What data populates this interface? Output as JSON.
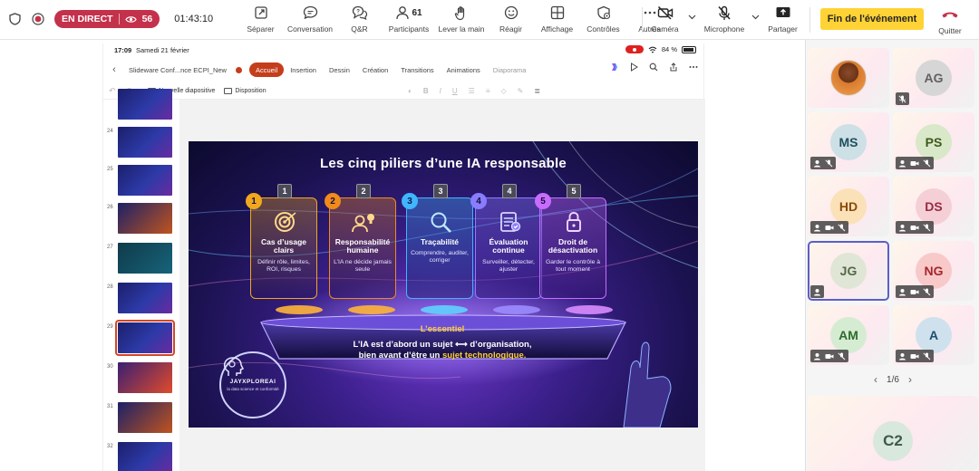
{
  "toolbar": {
    "live_label": "EN DIRECT",
    "viewer_count": "56",
    "timer": "01:43:10",
    "tools": [
      {
        "label": "Séparer",
        "icon": "pop-out-icon"
      },
      {
        "label": "Conversation",
        "icon": "chat-icon"
      },
      {
        "label": "Q&R",
        "icon": "qa-icon"
      },
      {
        "label": "Participants",
        "icon": "people-icon",
        "count": "61"
      },
      {
        "label": "Lever la main",
        "icon": "raise-hand-icon"
      },
      {
        "label": "Réagir",
        "icon": "smiley-icon"
      },
      {
        "label": "Affichage",
        "icon": "grid-view-icon"
      },
      {
        "label": "Contrôles",
        "icon": "controls-icon"
      },
      {
        "label": "Autres",
        "icon": "more-icon"
      },
      {
        "label": "Caméra",
        "icon": "camera-off-icon"
      },
      {
        "label": "Microphone",
        "icon": "mic-off-icon"
      },
      {
        "label": "Partager",
        "icon": "share-tray-icon"
      }
    ],
    "end_event": "Fin de l'événement",
    "quit": "Quitter",
    "colors": {
      "live": "#c4314b",
      "end": "#ffd335",
      "hangup": "#c4314b"
    }
  },
  "ipad": {
    "time": "17:09",
    "date": "Samedi 21 février",
    "battery": "84 %"
  },
  "powerpoint": {
    "file_name": "Slideware Conf...nce ECPI_New",
    "tabs": [
      "Accueil",
      "Insertion",
      "Dessin",
      "Création",
      "Transitions",
      "Animations",
      "Diaporama"
    ],
    "active_tab": "Accueil",
    "new_slide": "Nouvelle diapositive",
    "layout": "Disposition",
    "thumbnails": [
      {
        "number": ""
      },
      {
        "number": "24"
      },
      {
        "number": "25"
      },
      {
        "number": "26"
      },
      {
        "number": "27"
      },
      {
        "number": "28"
      },
      {
        "number": "29",
        "selected": true
      },
      {
        "number": "30"
      },
      {
        "number": "31"
      },
      {
        "number": "32"
      }
    ],
    "accent": "#c43e1c"
  },
  "slide": {
    "title": "Les cinq piliers d’une IA responsable",
    "pillars": [
      {
        "number": "1",
        "title": "Cas d’usage clairs",
        "desc": "Définir rôle, limites, ROI, risques",
        "color": "#f2a81d"
      },
      {
        "number": "2",
        "title": "Responsabilité humaine",
        "desc": "L’IA ne décide jamais seule",
        "color": "#f08a1a"
      },
      {
        "number": "3",
        "title": "Traçabilité",
        "desc": "Comprendre, auditer, corriger",
        "color": "#3fb6ff"
      },
      {
        "number": "4",
        "title": "Évaluation continue",
        "desc": "Surveiller, détecter, ajuster",
        "color": "#8a7cff"
      },
      {
        "number": "5",
        "title": "Droit de désactivation",
        "desc": "Garder le contrôle à tout moment",
        "color": "#c86cff"
      }
    ],
    "essentiel_heading": "L’essentiel",
    "essentiel_line1": "L’IA est d’abord un sujet ⟷ d’organisation,",
    "essentiel_line2a": "bien avant d’être un ",
    "essentiel_line2b": "sujet technologique.",
    "logo_text": "JAYXPLOREAI",
    "logo_sub": "la data science et conformité"
  },
  "participants": {
    "tiles": [
      {
        "initials": "",
        "photo": true,
        "bg": "#ffffff",
        "fg": "#ffffff"
      },
      {
        "initials": "AG",
        "bg": "#d6d6d6",
        "fg": "#616161"
      },
      {
        "initials": "MS",
        "bg": "#cde0e6",
        "fg": "#1f4e5f"
      },
      {
        "initials": "PS",
        "bg": "#d9e8c9",
        "fg": "#3d5a1a"
      },
      {
        "initials": "HD",
        "bg": "#fbe1b8",
        "fg": "#8a4b0a"
      },
      {
        "initials": "DS",
        "bg": "#f5cfd6",
        "fg": "#9a2a40"
      },
      {
        "initials": "JG",
        "bg": "#dfe6d6",
        "fg": "#55684a"
      },
      {
        "initials": "NG",
        "bg": "#f8c9c9",
        "fg": "#a4262c"
      },
      {
        "initials": "AM",
        "bg": "#d5ecd2",
        "fg": "#2e6b2a"
      },
      {
        "initials": "A",
        "bg": "#cfe1ec",
        "fg": "#1f4e6f"
      }
    ],
    "page": "1/6",
    "big_tile_initials": "C2"
  }
}
